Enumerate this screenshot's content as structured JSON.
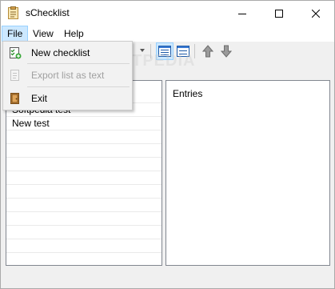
{
  "window": {
    "title": "sChecklist"
  },
  "menubar": {
    "items": [
      {
        "label": "File"
      },
      {
        "label": "View"
      },
      {
        "label": "Help"
      }
    ]
  },
  "file_menu": {
    "items": [
      {
        "label": "New checklist",
        "icon": "new-checklist-icon",
        "enabled": true
      },
      {
        "label": "Export list as text",
        "icon": "export-icon",
        "enabled": false
      },
      {
        "label": "Exit",
        "icon": "exit-door-icon",
        "enabled": true
      }
    ]
  },
  "checklists": {
    "items": [
      {
        "label": "Softpedia test"
      },
      {
        "label": "New test"
      }
    ]
  },
  "entries_panel": {
    "header": "Entries"
  },
  "watermark": "SOFTPEDIA",
  "colors": {
    "menu_highlight": "#cce8ff",
    "menu_highlight_border": "#99d1ff",
    "disabled_text": "#a0a0a0"
  }
}
